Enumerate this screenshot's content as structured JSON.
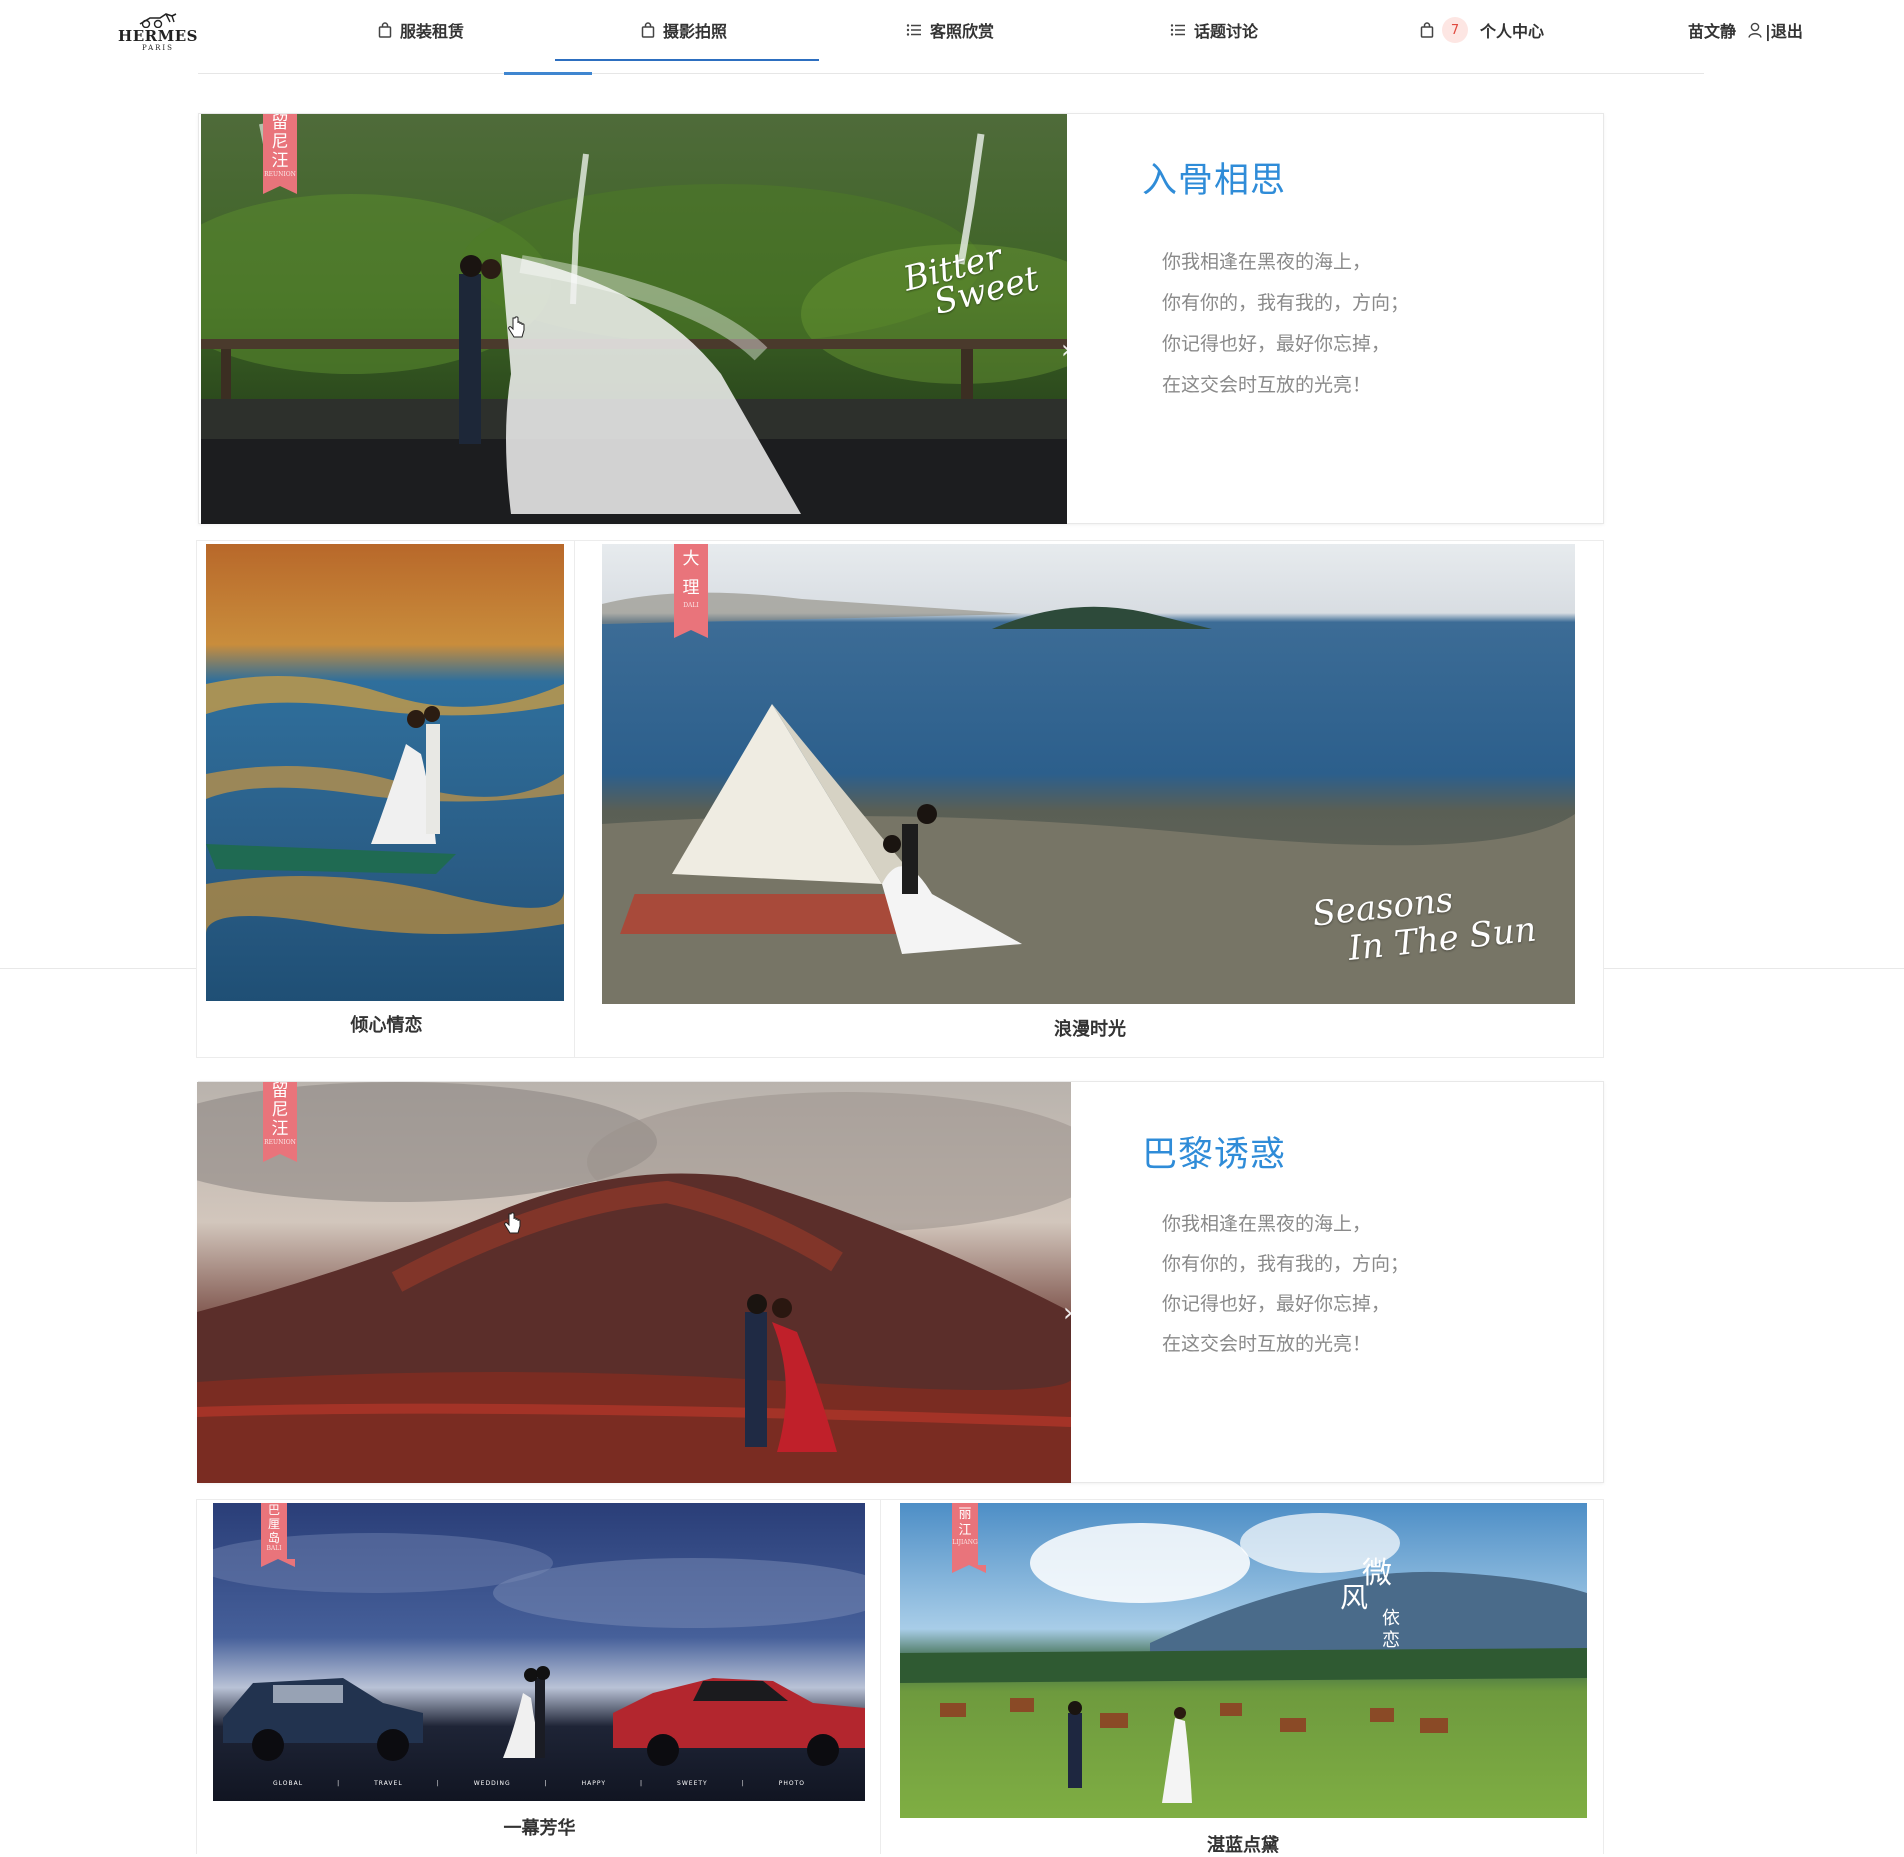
{
  "brand": {
    "name": "HERMES",
    "city": "PARIS"
  },
  "nav": [
    {
      "label": "服装租赁",
      "icon": "bag-icon"
    },
    {
      "label": "摄影拍照",
      "icon": "bag-icon",
      "active": true
    },
    {
      "label": "客照欣赏",
      "icon": "list-icon"
    },
    {
      "label": "话题讨论",
      "icon": "list-icon"
    },
    {
      "label": "个人中心",
      "icon": "bag-icon",
      "badge": "7"
    }
  ],
  "user": {
    "name": "苗文静",
    "logout": "|退出"
  },
  "features": [
    {
      "title": "入骨相思",
      "lines": [
        "你我相逢在黑夜的海上，",
        "你有你的，我有我的，方向；",
        "你记得也好，最好你忘掉，",
        "在这交会时互放的光亮！"
      ],
      "tag": {
        "text": [
          "留",
          "尼",
          "汪"
        ],
        "sub": "REUNION"
      },
      "overlay": [
        "Bitter",
        "Sweet"
      ]
    },
    {
      "title": "巴黎诱惑",
      "lines": [
        "你我相逢在黑夜的海上，",
        "你有你的，我有我的，方向；",
        "你记得也好，最好你忘掉，",
        "在这交会时互放的光亮！"
      ],
      "tag": {
        "text": [
          "留",
          "尼",
          "汪"
        ],
        "sub": "REUNION"
      }
    }
  ],
  "cards": [
    {
      "caption": "倾心情恋"
    },
    {
      "caption": "浪漫时光",
      "tag": {
        "text": [
          "大",
          "理"
        ],
        "sub": "DALI"
      },
      "overlay": [
        "Seasons",
        "In The Sun"
      ]
    },
    {
      "caption": "一幕芳华",
      "tag": {
        "text": [
          "巴",
          "厘",
          "岛"
        ],
        "sub": "BALI"
      },
      "strip": [
        "GLOBAL",
        "TRAVEL",
        "WEDDING",
        "HAPPY",
        "SWEETY",
        "PHOTO"
      ]
    },
    {
      "caption": "湛蓝点黛",
      "tag": {
        "text": [
          "丽",
          "江"
        ],
        "sub": "LIJIANG"
      },
      "overlay": [
        "微",
        "风",
        "依",
        "恋"
      ]
    }
  ],
  "colors": {
    "accent": "#2f8cd8",
    "underline": "#2d6fc0",
    "tag": "#e9747b",
    "badge_bg": "#fde6e3",
    "badge_text": "#e04a3f"
  }
}
